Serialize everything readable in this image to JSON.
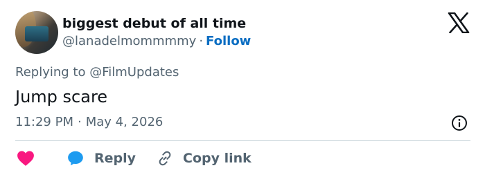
{
  "author": {
    "display_name": "biggest debut of all time",
    "handle": "@lanadelmommmmy",
    "separator": "·",
    "follow_label": "Follow"
  },
  "reply_context": {
    "prefix": "Replying to",
    "mention": "@FilmUpdates"
  },
  "tweet": {
    "text": "Jump scare",
    "time": "11:29 PM",
    "separator": "·",
    "date": "May 4, 2026"
  },
  "actions": {
    "reply_label": "Reply",
    "copy_link_label": "Copy link"
  },
  "icons": {
    "logo": "x-logo-icon",
    "info": "info-icon",
    "like": "heart-icon",
    "reply": "speech-bubble-icon",
    "copy": "link-icon"
  },
  "colors": {
    "like": "#f91880",
    "reply": "#1d9bf0",
    "follow": "#0a6dc2",
    "secondary_text": "#536471"
  }
}
